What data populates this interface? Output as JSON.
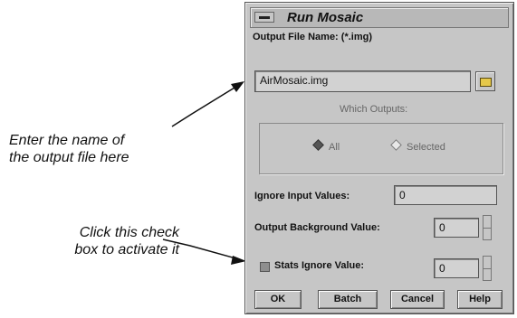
{
  "callouts": {
    "filename": [
      "Enter the name of",
      "the output file here"
    ],
    "checkbox": [
      "Click this check",
      "box to activate it"
    ]
  },
  "dialog": {
    "title": "Run Mosaic",
    "output_file_label": "Output File Name: (*.img)",
    "output_file_value": "AirMosaic.img",
    "which_outputs_label": "Which Outputs:",
    "radio_all": "All",
    "radio_selected": "Selected",
    "radio_selected_value": "All",
    "ignore_input_label": "Ignore Input Values:",
    "ignore_input_value": "0",
    "background_label": "Output Background Value:",
    "background_value": "0",
    "stats_ignore_label": "Stats Ignore Value:",
    "stats_ignore_value": "0",
    "stats_ignore_checked": false,
    "buttons": {
      "ok": "OK",
      "batch": "Batch",
      "cancel": "Cancel",
      "help": "Help"
    }
  },
  "icons": {
    "window_menu": "window-menu-icon",
    "file_browse": "folder-icon",
    "radio": "radio-diamond-icon",
    "spinner": "spinner-icon"
  },
  "colors": {
    "dialog_bg": "#c6c6c6",
    "field_bg": "#d2d2d2",
    "folder": "#e5c84a"
  }
}
